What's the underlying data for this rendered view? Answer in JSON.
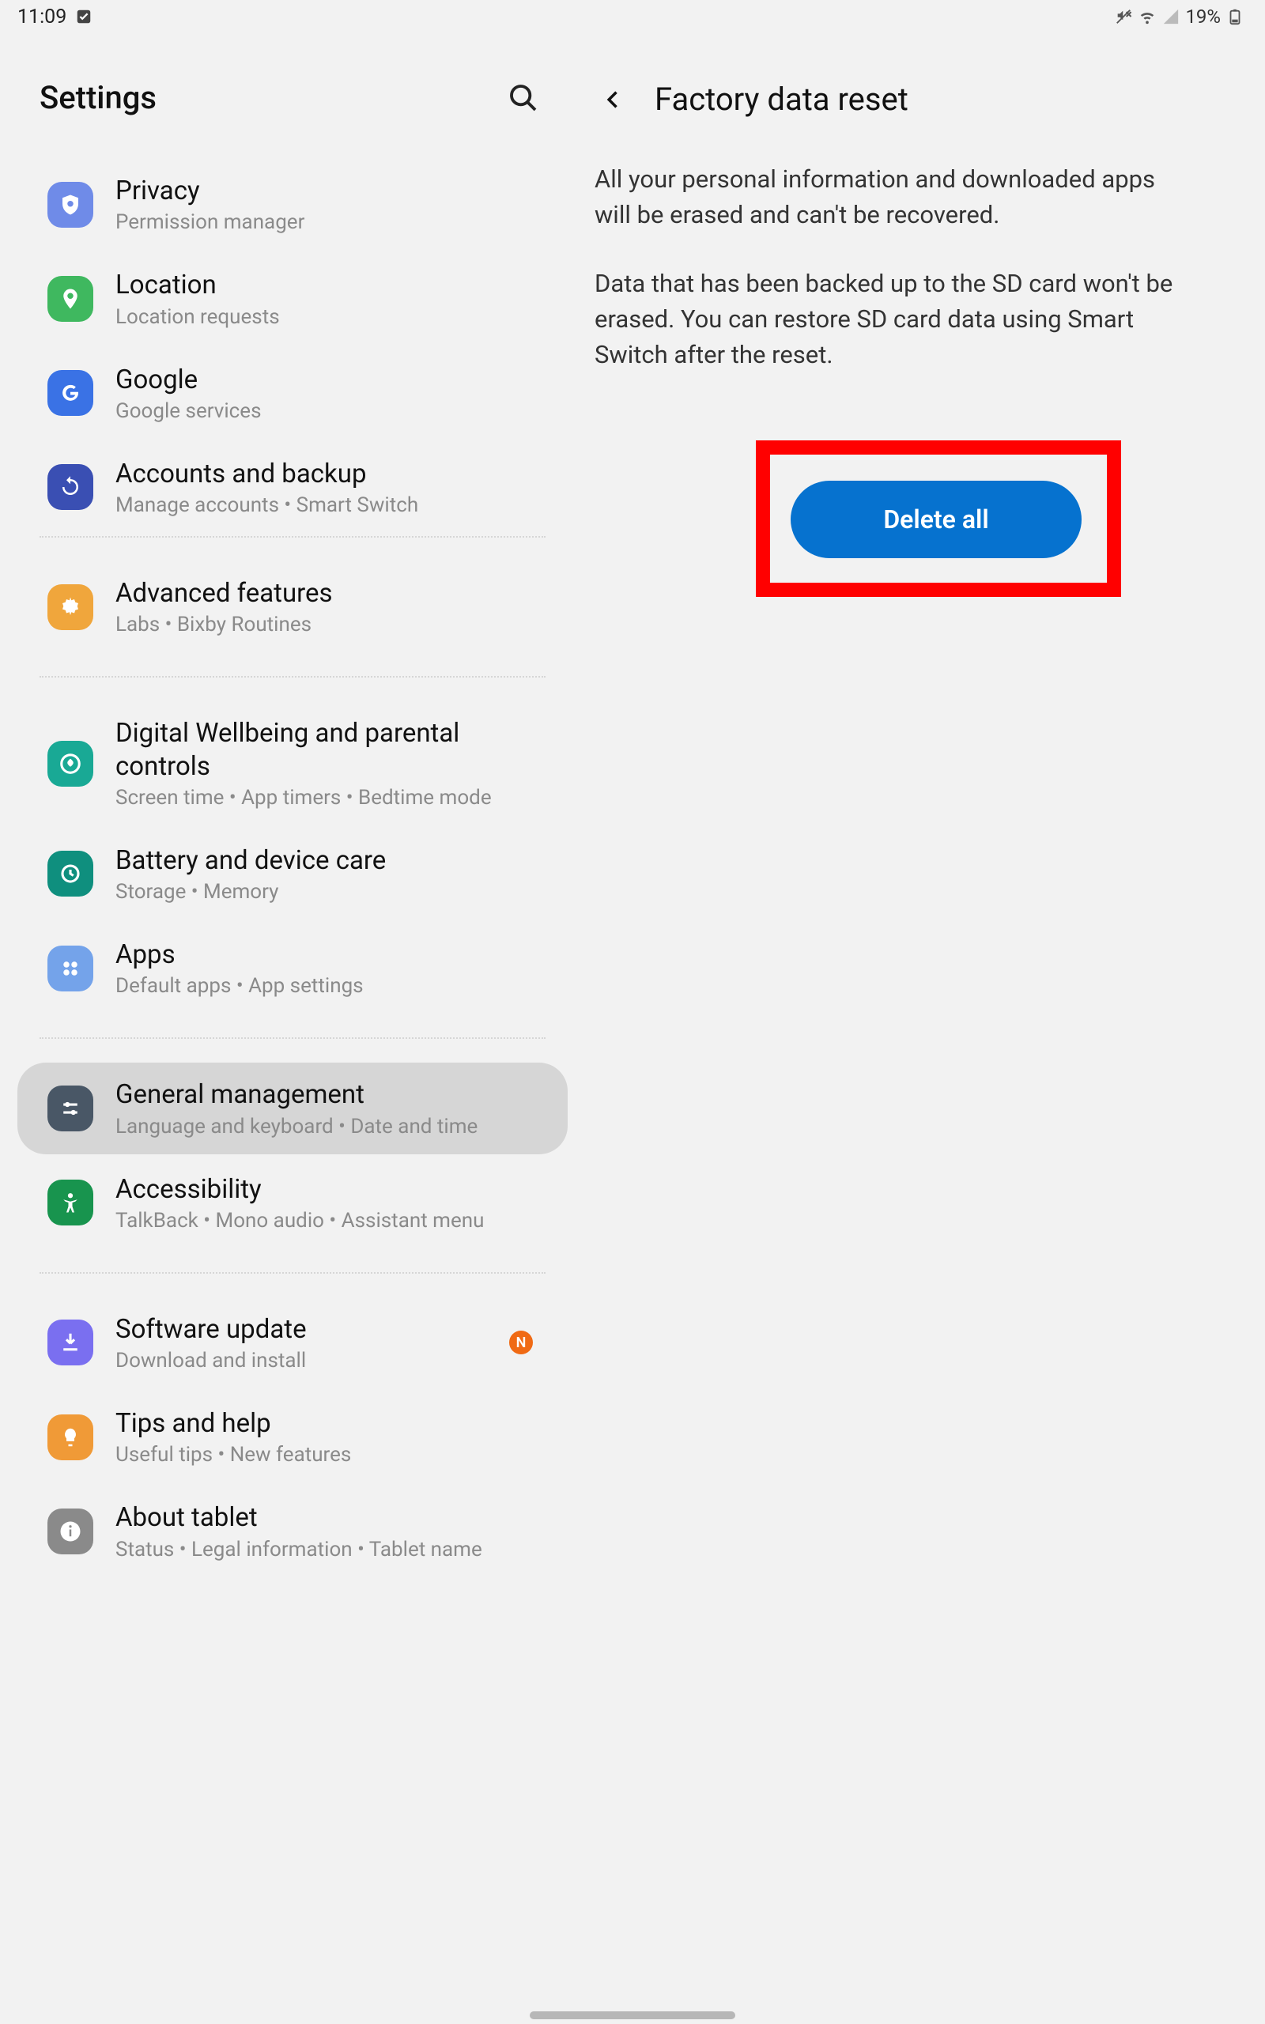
{
  "status": {
    "time": "11:09",
    "battery": "19%"
  },
  "header": {
    "left_title": "Settings",
    "right_title": "Factory data reset"
  },
  "detail": {
    "para1": "All your personal information and downloaded apps will be erased and can't be recovered.",
    "para2": "Data that has been backed up to the SD card won't be erased. You can restore SD card data using Smart Switch after the reset.",
    "delete_label": "Delete all"
  },
  "items": [
    {
      "title": "Privacy",
      "sub": "Permission manager"
    },
    {
      "title": "Location",
      "sub": "Location requests"
    },
    {
      "title": "Google",
      "sub": "Google services"
    },
    {
      "title": "Accounts and backup",
      "sub": "Manage accounts  •  Smart Switch"
    },
    {
      "title": "Advanced features",
      "sub": "Labs  •  Bixby Routines"
    },
    {
      "title": "Digital Wellbeing and parental controls",
      "sub": "Screen time  •  App timers  •  Bedtime mode"
    },
    {
      "title": "Battery and device care",
      "sub": "Storage  •  Memory"
    },
    {
      "title": "Apps",
      "sub": "Default apps  •  App settings"
    },
    {
      "title": "General management",
      "sub": "Language and keyboard  •  Date and time"
    },
    {
      "title": "Accessibility",
      "sub": "TalkBack  •  Mono audio  •  Assistant menu"
    },
    {
      "title": "Software update",
      "sub": "Download and install"
    },
    {
      "title": "Tips and help",
      "sub": "Useful tips  •  New features"
    },
    {
      "title": "About tablet",
      "sub": "Status  •  Legal information  •  Tablet name"
    }
  ],
  "badge": {
    "software_update": "N"
  }
}
